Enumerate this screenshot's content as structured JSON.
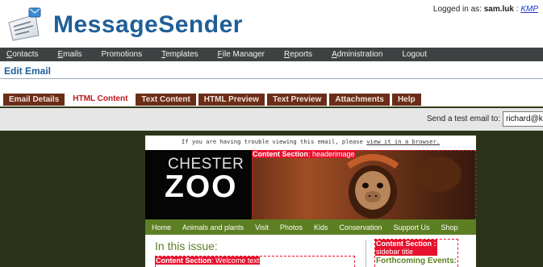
{
  "app": {
    "title": "MessageSender",
    "logo_icon": "envelope-list-icon",
    "login_prefix": "Logged in as:",
    "user": "sam.luk",
    "separator": ":",
    "org": "KMP"
  },
  "nav": {
    "items": [
      {
        "label": "Contacts",
        "accel": "C",
        "rest": "ontacts"
      },
      {
        "label": "Emails",
        "accel": "E",
        "rest": "mails"
      },
      {
        "label": "Promotions",
        "accel": "",
        "rest": "Promotions"
      },
      {
        "label": "Templates",
        "accel": "T",
        "rest": "emplates"
      },
      {
        "label": "File Manager",
        "accel": "F",
        "rest": "ile Manager"
      },
      {
        "label": "Reports",
        "accel": "R",
        "rest": "eports"
      },
      {
        "label": "Administration",
        "accel": "A",
        "rest": "dministration"
      },
      {
        "label": "Logout",
        "accel": "",
        "rest": "Logout"
      }
    ]
  },
  "page": {
    "title": "Edit Email"
  },
  "tabs": [
    {
      "label": "Email Details",
      "active": false
    },
    {
      "label": "HTML Content",
      "active": true
    },
    {
      "label": "Text Content",
      "active": false
    },
    {
      "label": "HTML Preview",
      "active": false
    },
    {
      "label": "Text Preview",
      "active": false
    },
    {
      "label": "Attachments",
      "active": false
    },
    {
      "label": "Help",
      "active": false
    }
  ],
  "test_email": {
    "label": "Send a test email to:",
    "value": "richard@km"
  },
  "email": {
    "trouble_text": "If you are having trouble viewing this email, please",
    "trouble_link": "view it in a browser.",
    "logo_line1": "CHESTER",
    "logo_line2": "ZOO",
    "header_tag_prefix": "Content Section",
    "header_tag_name": ": headerimage",
    "subnav": [
      "Home",
      "Animals and plants",
      "Visit",
      "Photos",
      "Kids",
      "Conservation",
      "Support Us",
      "Shop"
    ],
    "in_issue": "In this issue:",
    "welcome_tag_prefix": "Content Section",
    "welcome_tag_name": ": Welcome text",
    "sidebar_tag_line1": "Content Section :",
    "sidebar_tag_line2": "sidebar title",
    "sidebar_title": "Forthcoming Events:"
  }
}
